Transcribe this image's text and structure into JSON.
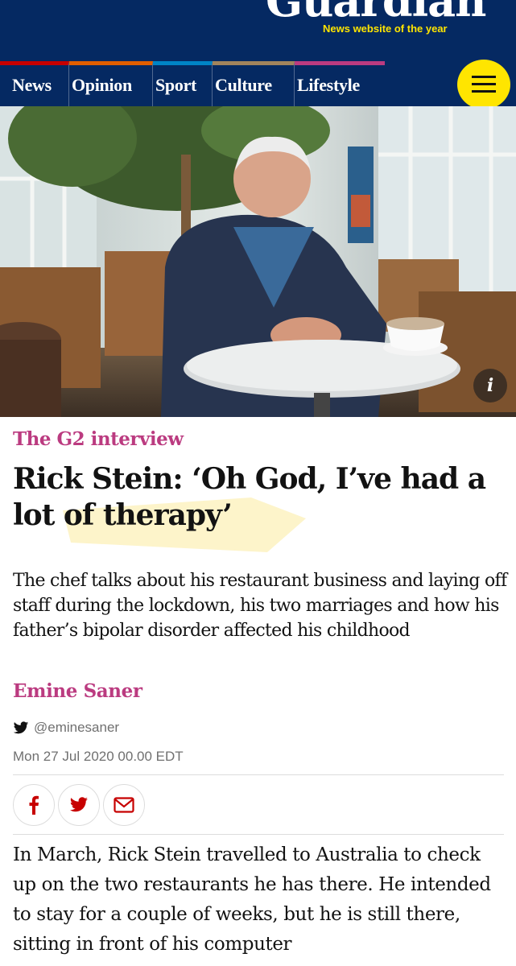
{
  "masthead": {
    "logo": "Guardian",
    "tagline": "News website of the year"
  },
  "nav": {
    "pillars": [
      {
        "label": "News",
        "color": "#c70000"
      },
      {
        "label": "Opinion",
        "color": "#e05e00"
      },
      {
        "label": "Sport",
        "color": "#0084c6"
      },
      {
        "label": "Culture",
        "color": "#a1845c"
      },
      {
        "label": "Lifestyle",
        "color": "#bb3b80"
      }
    ],
    "menu_icon": "hamburger-icon"
  },
  "hero": {
    "info_label": "i"
  },
  "article": {
    "kicker": "The G2 interview",
    "headline": "Rick Stein: ‘Oh God, I’ve had a lot of therapy’",
    "standfirst": "The chef talks about his restaurant business and laying off staff during the lockdown, his two marriages and how his father’s bipolar disorder affected his childhood",
    "byline": "Emine Saner",
    "twitter_handle": "@eminesaner",
    "date": "Mon 27 Jul 2020 00.00 EDT",
    "share_icons": [
      "facebook-icon",
      "twitter-icon",
      "email-icon"
    ],
    "body": "In March, Rick Stein travelled to Australia to check up on the two restaurants he has there. He intended to stay for a couple of weeks, but he is still there, sitting in front of his computer"
  },
  "colors": {
    "brand_blue": "#052962",
    "yellow": "#ffe500",
    "lifestyle_pink": "#bb3b80",
    "highlighter": "#fdf3c4"
  }
}
